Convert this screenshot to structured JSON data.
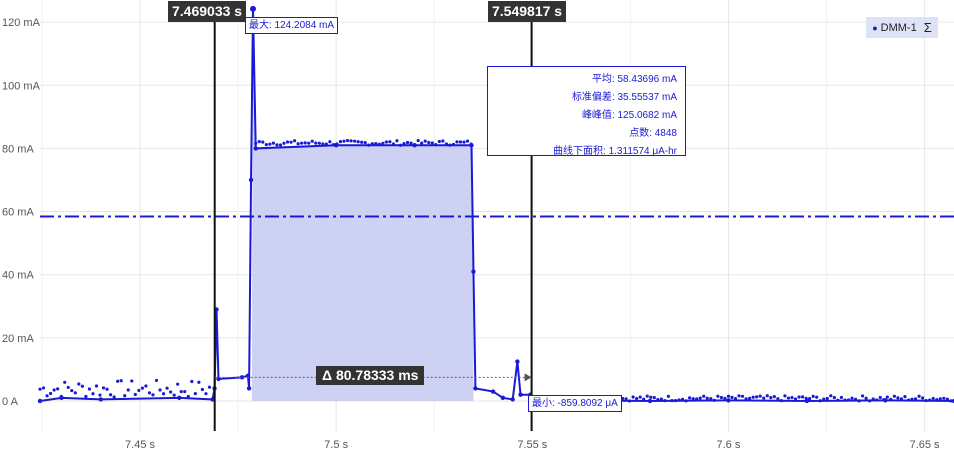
{
  "chart_data": {
    "type": "line",
    "title": "",
    "xlabel": "",
    "ylabel": "",
    "xlim": [
      7.4245,
      7.6575
    ],
    "ylim": [
      -9.5,
      127
    ],
    "x_ticks": [
      {
        "value": 7.45,
        "label": "7.45 s"
      },
      {
        "value": 7.5,
        "label": "7.5 s"
      },
      {
        "value": 7.55,
        "label": "7.55 s"
      },
      {
        "value": 7.6,
        "label": "7.6 s"
      },
      {
        "value": 7.65,
        "label": "7.65 s"
      }
    ],
    "y_ticks": [
      {
        "value": 0,
        "label": "0 A"
      },
      {
        "value": 20,
        "label": "20 mA"
      },
      {
        "value": 40,
        "label": "40 mA"
      },
      {
        "value": 60,
        "label": "60 mA"
      },
      {
        "value": 80,
        "label": "80 mA"
      },
      {
        "value": 100,
        "label": "100 mA"
      },
      {
        "value": 120,
        "label": "120 mA"
      }
    ],
    "grid": true,
    "legend_position": "top-right",
    "series": [
      {
        "name": "DMM-1",
        "color": "#1a1ad6",
        "points": [
          [
            7.4245,
            0
          ],
          [
            7.43,
            1
          ],
          [
            7.44,
            0.5
          ],
          [
            7.46,
            1
          ],
          [
            7.4685,
            0.5
          ],
          [
            7.469,
            4
          ],
          [
            7.4695,
            29
          ],
          [
            7.47,
            7
          ],
          [
            7.476,
            7.5
          ],
          [
            7.4775,
            8
          ],
          [
            7.4778,
            4
          ],
          [
            7.4783,
            70
          ],
          [
            7.4788,
            124.2
          ],
          [
            7.4795,
            80
          ],
          [
            7.5,
            81
          ],
          [
            7.52,
            81
          ],
          [
            7.5345,
            81
          ],
          [
            7.535,
            41
          ],
          [
            7.5355,
            4
          ],
          [
            7.54,
            3
          ],
          [
            7.5425,
            1
          ],
          [
            7.545,
            0.5
          ],
          [
            7.5462,
            12.5
          ],
          [
            7.547,
            2
          ],
          [
            7.5495,
            2
          ],
          [
            7.5505,
            -0.86
          ],
          [
            7.56,
            0.2
          ],
          [
            7.58,
            0
          ],
          [
            7.6,
            0.2
          ],
          [
            7.62,
            0
          ],
          [
            7.64,
            0.2
          ],
          [
            7.6575,
            0
          ]
        ]
      }
    ],
    "mean_line": 58.43696,
    "cursors": [
      {
        "value": 7.469033,
        "label": "7.469033 s"
      },
      {
        "value": 7.549817,
        "label": "7.549817 s"
      }
    ],
    "shaded_region": {
      "from": 7.4785,
      "to": 7.535
    },
    "delta_label": "Δ 80.78333 ms",
    "max_marker": {
      "x": 7.4788,
      "y": 124.2084,
      "label": "最大: 124.2084 mA"
    },
    "min_marker": {
      "x": 7.5505,
      "y": -0.8598092,
      "label": "最小: -859.8092 μA"
    },
    "stats": [
      {
        "label": "平均",
        "value": "58.43696 mA"
      },
      {
        "label": "标准偏差",
        "value": "35.55537 mA"
      },
      {
        "label": "峰峰值",
        "value": "125.0682 mA"
      },
      {
        "label": "点数",
        "value": "4848"
      },
      {
        "label": "曲线下面积",
        "value": "1.311574 μA-hr"
      }
    ]
  },
  "legend": {
    "series_name": "DMM-1",
    "sigma_icon": "sigma-icon",
    "sigma_symbol": "Σ"
  },
  "colors": {
    "series": "#1a1ad6",
    "fill": "#c8ccf2",
    "cursor": "#111111",
    "grid": "#e6e6e6"
  }
}
